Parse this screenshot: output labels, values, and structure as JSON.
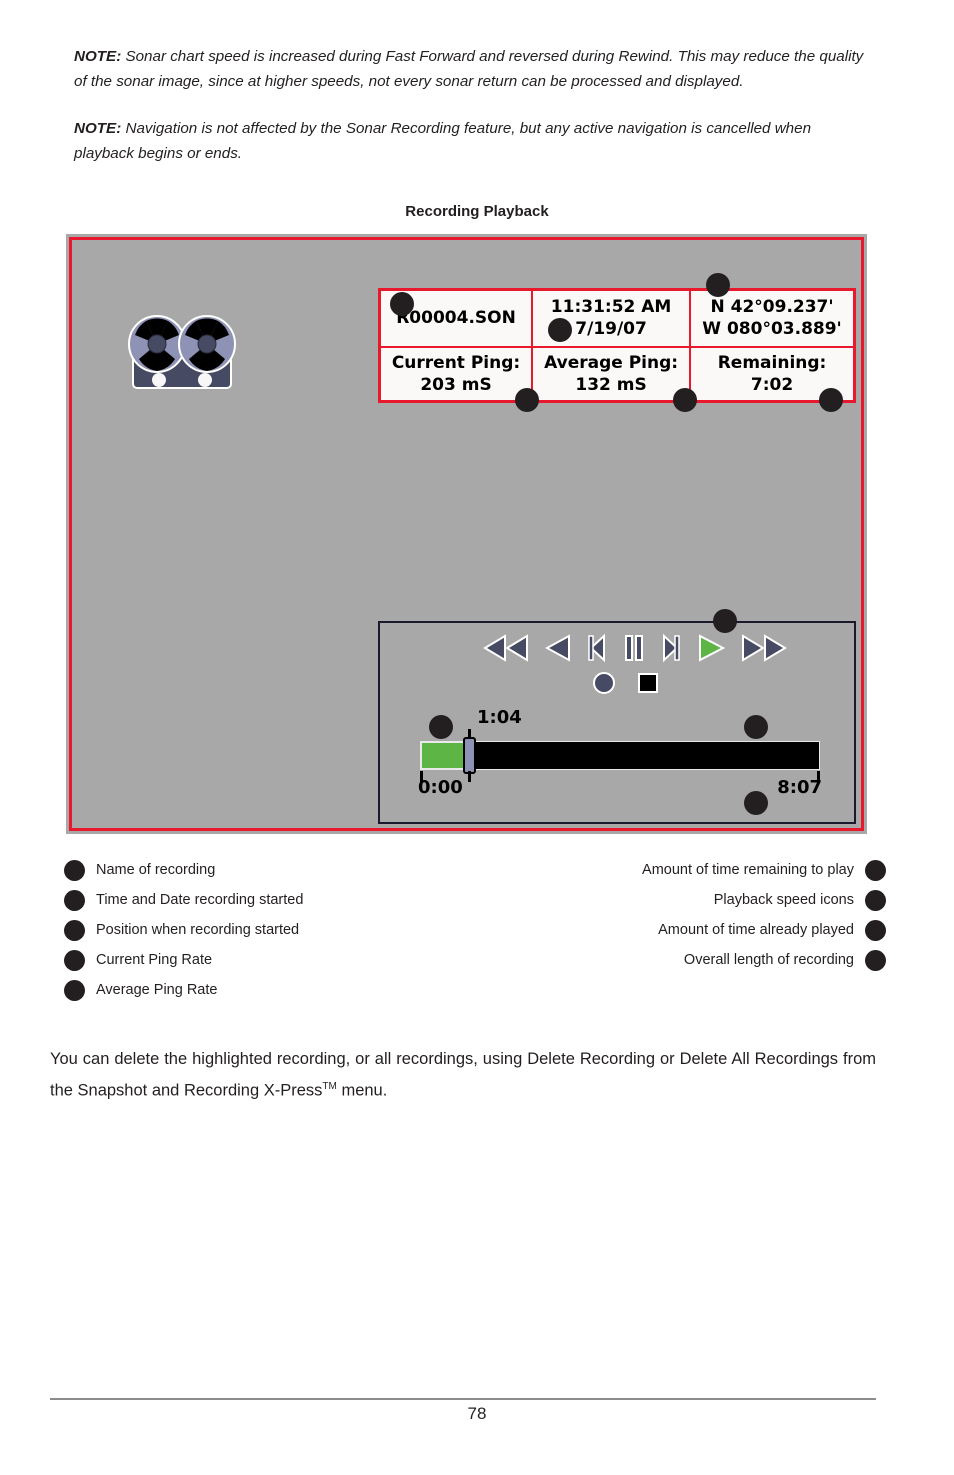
{
  "notes": [
    {
      "label": "NOTE:",
      "text": " Sonar chart speed is increased during Fast Forward and reversed during Rewind. This may reduce the quality of the sonar image, since at higher speeds, not every sonar return can be processed and displayed."
    },
    {
      "label": "NOTE:",
      "text": " Navigation is not affected by the Sonar Recording feature, but any active navigation is cancelled when playback begins or ends."
    }
  ],
  "caption": "Recording Playback",
  "screen": {
    "reel_icon": "tape-reel-icon",
    "table": {
      "row1": {
        "recording_name": "R00004.SON",
        "time": "11:31:52 AM",
        "date": "7/19/07",
        "latitude": "N 42°09.237'",
        "longitude": "W 080°03.889'"
      },
      "row2": {
        "current_ping_label": "Current Ping:",
        "current_ping_value": "203 mS",
        "average_ping_label": "Average Ping:",
        "average_ping_value": "132 mS",
        "remaining_label": "Remaining:",
        "remaining_value": "7:02"
      }
    },
    "playback": {
      "icons": [
        {
          "name": "fast-rewind-icon",
          "glyph": "double-left",
          "color": "#474a63",
          "active": false
        },
        {
          "name": "rewind-icon",
          "glyph": "single-left",
          "color": "#474a63",
          "active": false
        },
        {
          "name": "step-back-icon",
          "glyph": "bracket-left",
          "color": "#474a63",
          "active": false
        },
        {
          "name": "pause-icon",
          "glyph": "pause",
          "color": "#474a63",
          "active": false
        },
        {
          "name": "step-forward-icon",
          "glyph": "bracket-right",
          "color": "#474a63",
          "active": false
        },
        {
          "name": "play-icon",
          "glyph": "single-right",
          "color": "#5cb545",
          "active": true
        },
        {
          "name": "fast-forward-icon",
          "glyph": "double-right",
          "color": "#474a63",
          "active": false
        }
      ],
      "record_icon": "record-icon",
      "stop_icon": "stop-icon",
      "slider": {
        "current_time": "1:04",
        "start_time": "0:00",
        "end_time": "8:07",
        "played_fraction": 0.112,
        "fill_color": "#5cb545",
        "track_color": "#000000",
        "handle_color": "#8e92b4"
      }
    }
  },
  "legend_left": [
    "Name of recording",
    "Time and Date recording started",
    "Position when recording started",
    "Current Ping Rate",
    "Average Ping Rate"
  ],
  "legend_right": [
    "Amount of time remaining to play",
    "Playback speed icons",
    "Amount of time already played",
    "Overall length of recording"
  ],
  "body_paragraph": {
    "part1": "You can delete the highlighted recording, or all recordings, using Delete Recording or Delete All Recordings from the Snapshot and Recording X-Press",
    "tm": "TM",
    "part2": " menu."
  },
  "footer": {
    "page_number": "78"
  },
  "colors": {
    "accent_red": "#e8192c",
    "screen_gray": "#a8a8a8",
    "green": "#5cb545",
    "icon_slate": "#474a63",
    "ink": "#231f20"
  }
}
